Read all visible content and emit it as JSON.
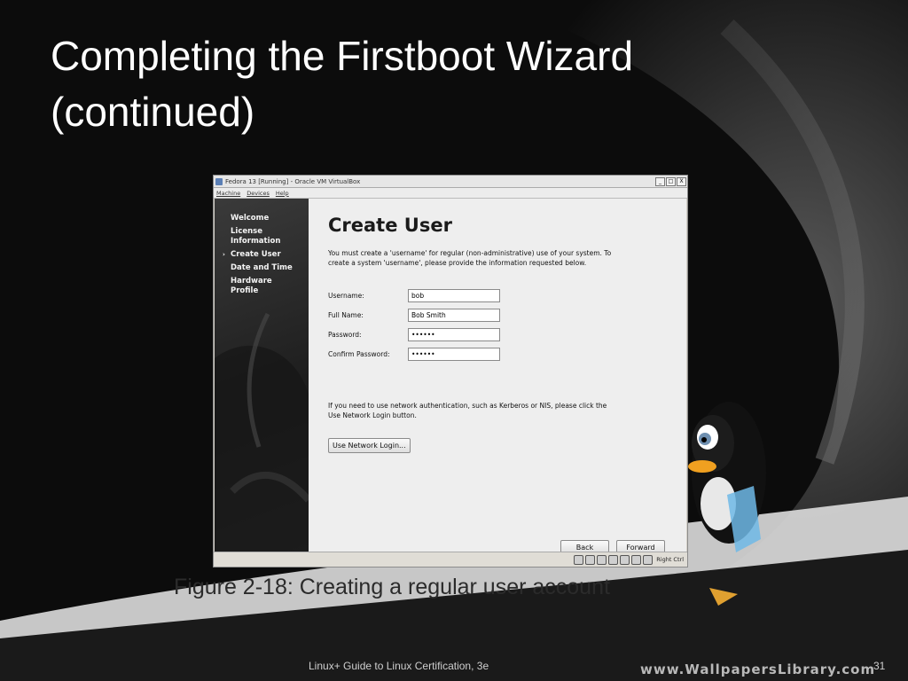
{
  "slide": {
    "title_line1": "Completing the Firstboot Wizard",
    "title_line2": "(continued)",
    "caption": "Figure 2-18: Creating a regular user account",
    "footer": "Linux+ Guide to Linux Certification, 3e",
    "slide_number": "31",
    "watermark": "www.WallpapersLibrary.com"
  },
  "vm_window": {
    "title": "Fedora 13 [Running] - Oracle VM VirtualBox",
    "menu": [
      "Machine",
      "Devices",
      "Help"
    ],
    "controls": [
      "_",
      "□",
      "X"
    ],
    "status_host_key": "Right Ctrl"
  },
  "firstboot": {
    "steps": [
      {
        "label": "Welcome",
        "current": false
      },
      {
        "label": "License Information",
        "current": false
      },
      {
        "label": "Create User",
        "current": true
      },
      {
        "label": "Date and Time",
        "current": false
      },
      {
        "label": "Hardware Profile",
        "current": false
      }
    ],
    "current_arrow": "›",
    "heading": "Create User",
    "intro": "You must create a 'username' for regular (non-administrative) use of your system.  To create a system 'username', please provide the information requested below.",
    "fields": {
      "username": {
        "label": "Username:",
        "value": "bob"
      },
      "fullname": {
        "label": "Full Name:",
        "value": "Bob Smith"
      },
      "password": {
        "label": "Password:",
        "value": "••••••"
      },
      "confirm": {
        "label": "Confirm Password:",
        "value": "••••••"
      }
    },
    "network_note": "If you need to use network authentication, such as Kerberos or NIS, please click the Use Network Login button.",
    "network_button": "Use Network Login...",
    "back_button": "Back",
    "forward_button": "Forward"
  }
}
